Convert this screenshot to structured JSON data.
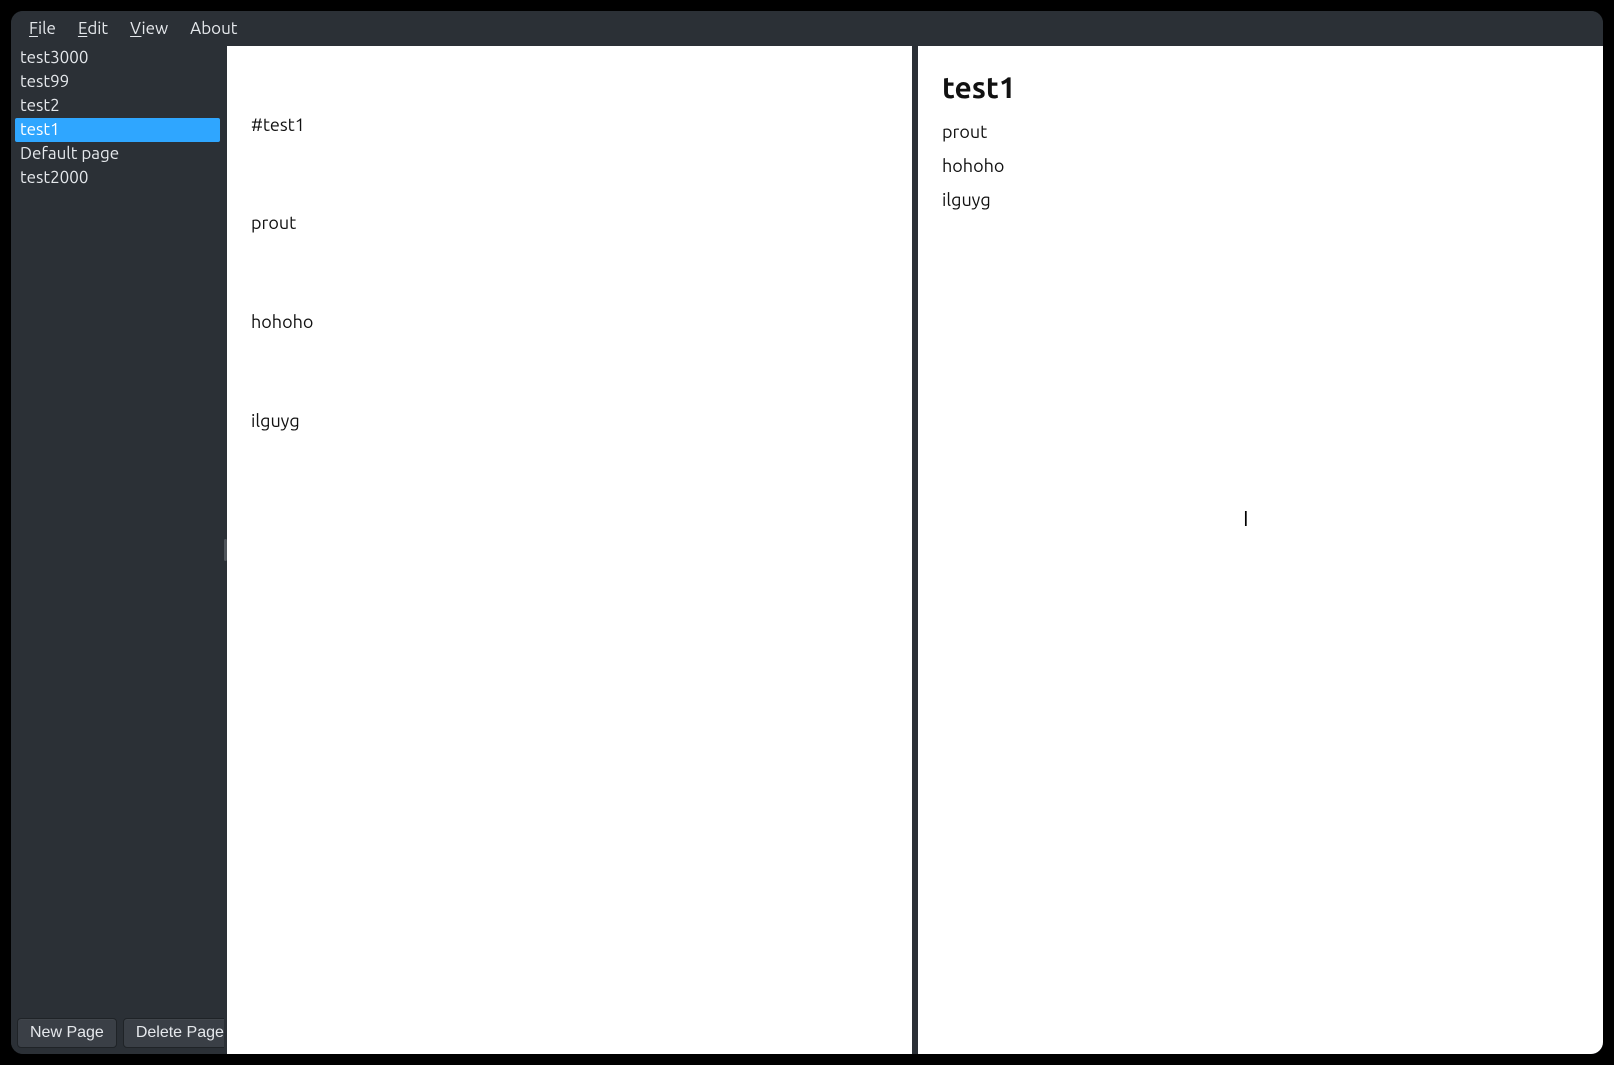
{
  "menubar": {
    "items": [
      {
        "label": "File",
        "mnemonic_index": 0
      },
      {
        "label": "Edit",
        "mnemonic_index": 0
      },
      {
        "label": "View",
        "mnemonic_index": 0
      },
      {
        "label": "About",
        "mnemonic_index": null
      }
    ]
  },
  "sidebar": {
    "pages": [
      {
        "name": "test3000",
        "selected": false
      },
      {
        "name": "test99",
        "selected": false
      },
      {
        "name": "test2",
        "selected": false
      },
      {
        "name": "test1",
        "selected": true
      },
      {
        "name": "Default page",
        "selected": false
      },
      {
        "name": "test2000",
        "selected": false
      }
    ],
    "buttons": {
      "new_page": "New Page",
      "delete_page": "Delete Page"
    }
  },
  "editor": {
    "lines": [
      "#test1",
      "prout",
      "hohoho",
      "ilguyg"
    ]
  },
  "preview": {
    "heading": "test1",
    "paragraphs": [
      "prout",
      "hohoho",
      "ilguyg"
    ]
  }
}
